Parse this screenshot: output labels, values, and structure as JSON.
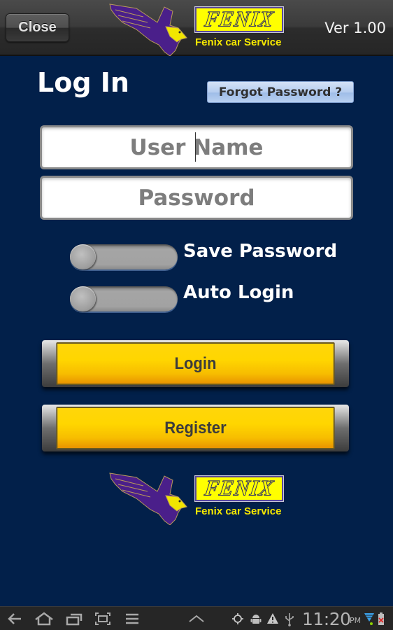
{
  "header": {
    "close_label": "Close",
    "version": "Ver 1.00"
  },
  "logo": {
    "brand": "FENIX",
    "tagline": "Fenix car Service",
    "colors": {
      "eagle": "#4a1f8a",
      "brand_yellow": "#ffff00"
    }
  },
  "login": {
    "title": "Log In",
    "forgot_password_label": "Forgot Password ?",
    "username": {
      "value": "",
      "placeholder": "User Name"
    },
    "password": {
      "value": "",
      "placeholder": "Password"
    },
    "toggles": [
      {
        "label": "Save Password",
        "state": "off"
      },
      {
        "label": "Auto Login",
        "state": "off"
      }
    ],
    "login_label": "Login",
    "register_label": "Register"
  },
  "colors": {
    "background": "#02204a",
    "button_yellow": "#ffd600",
    "header": "#3b3b3b"
  },
  "system_bar": {
    "nav_icons": [
      "back-icon",
      "home-icon",
      "recent-apps-icon",
      "screenshot-icon",
      "menu-icon",
      "chevron-up-icon"
    ],
    "status_icons": [
      "gps-icon",
      "android-debug-icon",
      "warning-icon",
      "usb-icon",
      "wifi-icon",
      "battery-icon"
    ],
    "time": "11:20",
    "ampm": "PM"
  }
}
